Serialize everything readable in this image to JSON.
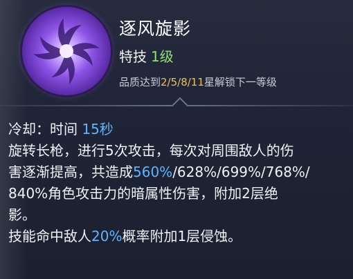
{
  "skill": {
    "name": "逐风旋影",
    "type_label": "特技",
    "level": "1级",
    "unlock_prefix": "品质达到",
    "unlock_stars": "2/5/8/11",
    "unlock_suffix": "星解锁下一等级",
    "icon": "whirlwind-spiral-icon"
  },
  "cooldown": {
    "label": "冷却：时间",
    "value": "15秒"
  },
  "description": {
    "line1": "旋转长枪，进行5次攻击，每次对周围敌人的伤",
    "line2_a": "害逐渐提高，共造成",
    "line2_b": "560%",
    "line2_c": "/628%/699%/768%/",
    "line3": "840%角色攻击力的暗属性伤害，附加2层绝",
    "line4": "影。",
    "line5_a": "技能命中敌人",
    "line5_b": "20%",
    "line5_c": "概率附加1层侵蚀。"
  },
  "colors": {
    "accent_blue": "#5cb6ff",
    "level_green": "#8fe07a",
    "star_gold": "#f0c24a",
    "icon_purple": "#8d55e6"
  }
}
